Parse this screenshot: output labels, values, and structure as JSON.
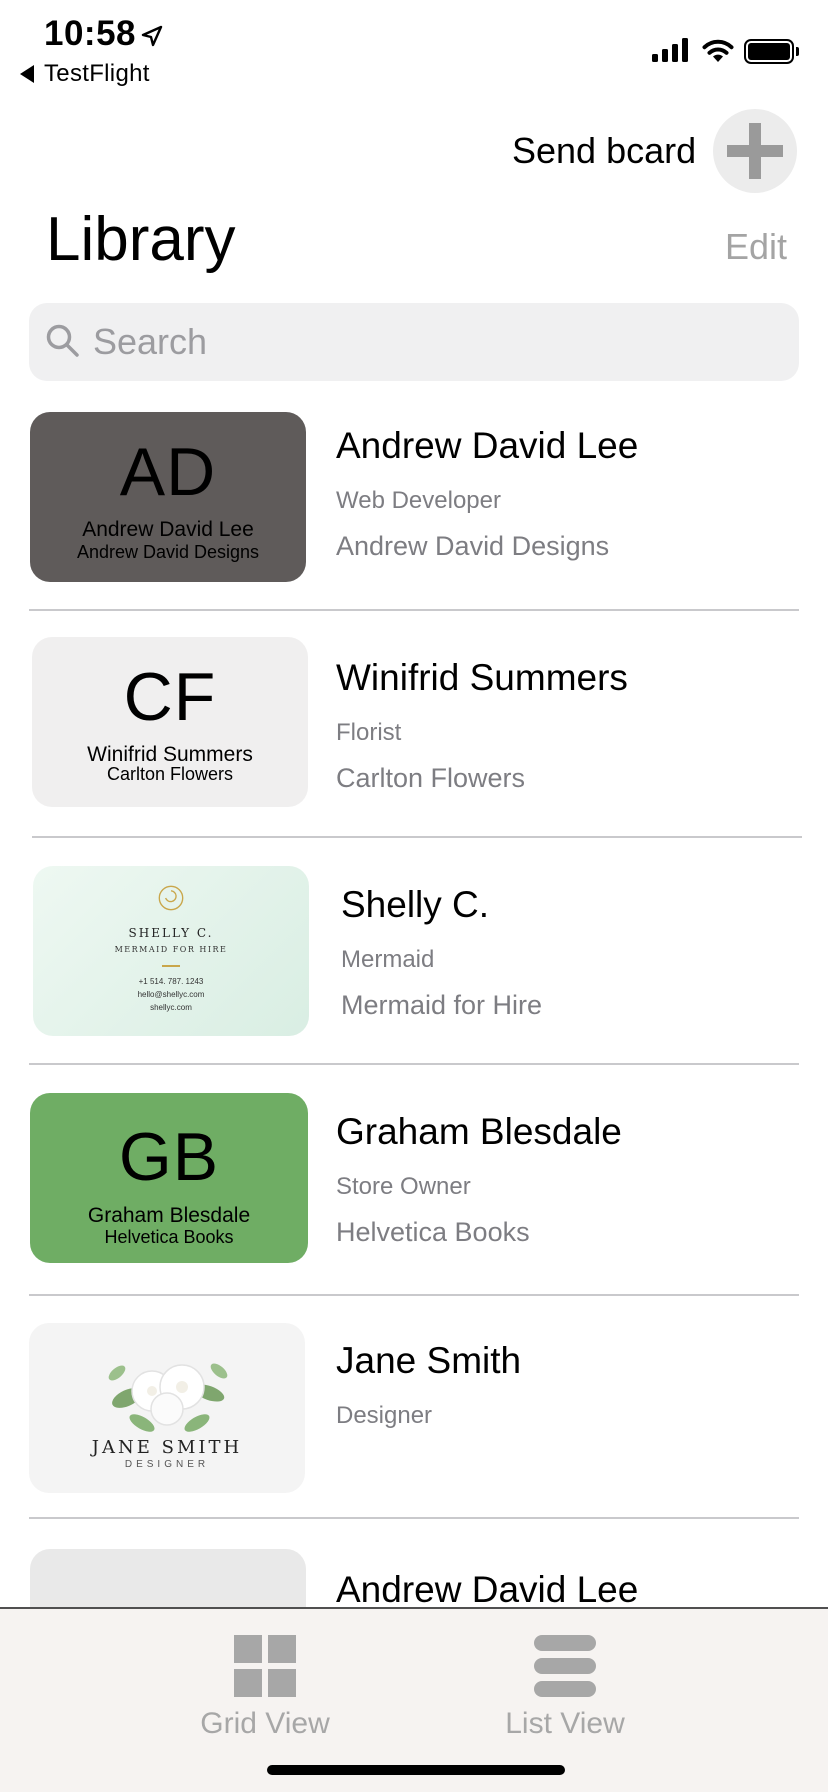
{
  "status_bar": {
    "time": "10:58",
    "back_label": "TestFlight"
  },
  "header": {
    "send_label": "Send bcard",
    "title": "Library",
    "edit_label": "Edit"
  },
  "search": {
    "placeholder": "Search"
  },
  "contacts": [
    {
      "name": "Andrew David Lee",
      "title": "Web Developer",
      "company": "Andrew David Designs",
      "card": {
        "initials": "AD",
        "name": "Andrew David Lee",
        "company": "Andrew David Designs",
        "bg": "#5f5b5a"
      }
    },
    {
      "name": "Winifrid Summers",
      "title": "Florist",
      "company": "Carlton Flowers",
      "card": {
        "initials": "CF",
        "name": "Winifrid Summers",
        "company": "Carlton Flowers",
        "bg": "#f0efef"
      }
    },
    {
      "name": "Shelly C.",
      "title": "Mermaid",
      "company": "Mermaid for Hire",
      "card": {
        "name": "SHELLY C.",
        "tagline": "MERMAID FOR HIRE",
        "phone": "+1 514. 787. 1243",
        "email": "hello@shellyc.com",
        "web": "shellyc.com",
        "bg": "#e3f2ea",
        "accent": "#c9a64a"
      }
    },
    {
      "name": "Graham Blesdale",
      "title": "Store Owner",
      "company": "Helvetica Books",
      "card": {
        "initials": "GB",
        "name": "Graham Blesdale",
        "company": "Helvetica Books",
        "bg": "#6fad64"
      }
    },
    {
      "name": "Jane Smith",
      "title": "Designer",
      "company": "",
      "card": {
        "name": "JANE SMITH",
        "tagline": "DESIGNER",
        "bg": "#f4f4f4"
      }
    },
    {
      "name": "Andrew David Lee",
      "title": "",
      "company": "",
      "card": {
        "bg": "#e9e9e9"
      }
    }
  ],
  "tabbar": {
    "grid_label": "Grid View",
    "list_label": "List View"
  }
}
